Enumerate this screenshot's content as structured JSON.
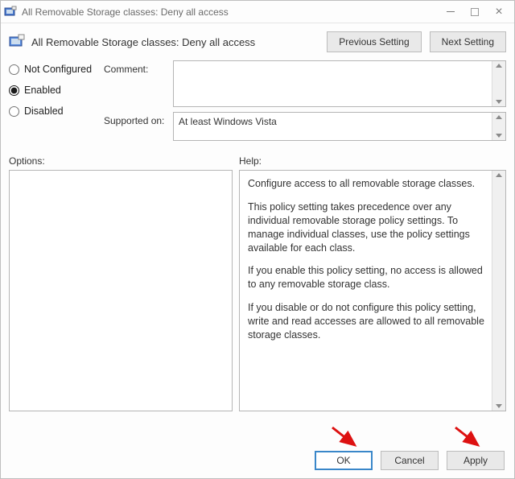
{
  "window": {
    "title": "All Removable Storage classes: Deny all access"
  },
  "header": {
    "policy_name": "All Removable Storage classes: Deny all access",
    "previous_label": "Previous Setting",
    "next_label": "Next Setting"
  },
  "radios": {
    "not_configured": "Not Configured",
    "enabled": "Enabled",
    "disabled": "Disabled",
    "selected": "enabled"
  },
  "fields": {
    "comment_label": "Comment:",
    "comment_value": "",
    "supported_label": "Supported on:",
    "supported_value": "At least Windows Vista"
  },
  "labels": {
    "options": "Options:",
    "help": "Help:"
  },
  "help": {
    "p1": "Configure access to all removable storage classes.",
    "p2": "This policy setting takes precedence over any individual removable storage policy settings. To manage individual classes, use the policy settings available for each class.",
    "p3": "If you enable this policy setting, no access is allowed to any removable storage class.",
    "p4": "If you disable or do not configure this policy setting, write and read accesses are allowed to all removable storage classes."
  },
  "footer": {
    "ok": "OK",
    "cancel": "Cancel",
    "apply": "Apply"
  }
}
